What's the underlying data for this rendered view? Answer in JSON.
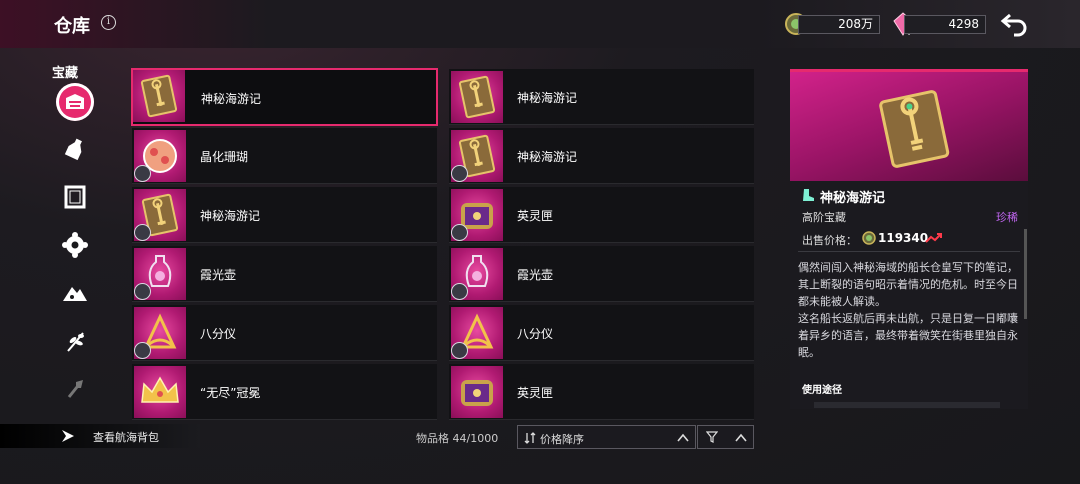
{
  "header": {
    "title": "仓库",
    "info_icon": "i",
    "currency_gold": "208万",
    "currency_gem": "4298",
    "back_icon": "back-arrow-icon"
  },
  "sidebar": {
    "category_label": "宝藏",
    "items": [
      {
        "icon": "treasure-chest-icon",
        "active": true
      },
      {
        "icon": "potion-bottle-icon",
        "active": false
      },
      {
        "icon": "picture-frame-icon",
        "active": false
      },
      {
        "icon": "gear-flower-icon",
        "active": false
      },
      {
        "icon": "mountain-cloud-icon",
        "active": false
      },
      {
        "icon": "plant-sprout-icon",
        "active": false
      },
      {
        "icon": "shovel-icon",
        "active": false
      }
    ]
  },
  "grid": {
    "items": [
      {
        "name": "神秘海游记",
        "icon": "key-book-icon",
        "badge": false,
        "selected": true
      },
      {
        "name": "神秘海游记",
        "icon": "key-book-icon",
        "badge": false,
        "selected": false
      },
      {
        "name": "晶化珊瑚",
        "icon": "coral-icon",
        "badge": true,
        "selected": false
      },
      {
        "name": "神秘海游记",
        "icon": "key-book-icon",
        "badge": true,
        "selected": false
      },
      {
        "name": "神秘海游记",
        "icon": "key-book-icon",
        "badge": true,
        "selected": false
      },
      {
        "name": "英灵匣",
        "icon": "treasure-box-icon",
        "badge": true,
        "selected": false
      },
      {
        "name": "霞光壶",
        "icon": "vase-icon",
        "badge": true,
        "selected": false
      },
      {
        "name": "霞光壶",
        "icon": "vase-icon",
        "badge": true,
        "selected": false
      },
      {
        "name": "八分仪",
        "icon": "octant-icon",
        "badge": true,
        "selected": false
      },
      {
        "name": "八分仪",
        "icon": "octant-icon",
        "badge": true,
        "selected": false
      },
      {
        "name": "“无尽”冠冕",
        "icon": "crown-icon",
        "badge": false,
        "selected": false
      },
      {
        "name": "英灵匣",
        "icon": "treasure-box-icon",
        "badge": false,
        "selected": false
      }
    ]
  },
  "footer": {
    "view_bag": "查看航海背包",
    "slots": "物品格 44/1000",
    "sort_label": "价格降序"
  },
  "detail": {
    "name": "神秘海游记",
    "type": "高阶宝藏",
    "rarity": "珍稀",
    "price_label": "出售价格：",
    "price_value": "119340",
    "description": "偶然间闯入神秘海域的船长仓皇写下的笔记，其上断裂的语句昭示着情况的危机。时至今日都未能被人解读。\n这名船长返航后再未出航，只是日复一日嘟囔着异乡的语言，最终带着微笑在街巷里独自永眠。",
    "uses_label": "使用途径"
  },
  "colors": {
    "accent": "#e62a6e",
    "rarity": "#c065f0",
    "thumb_bg": "#b01a72"
  }
}
